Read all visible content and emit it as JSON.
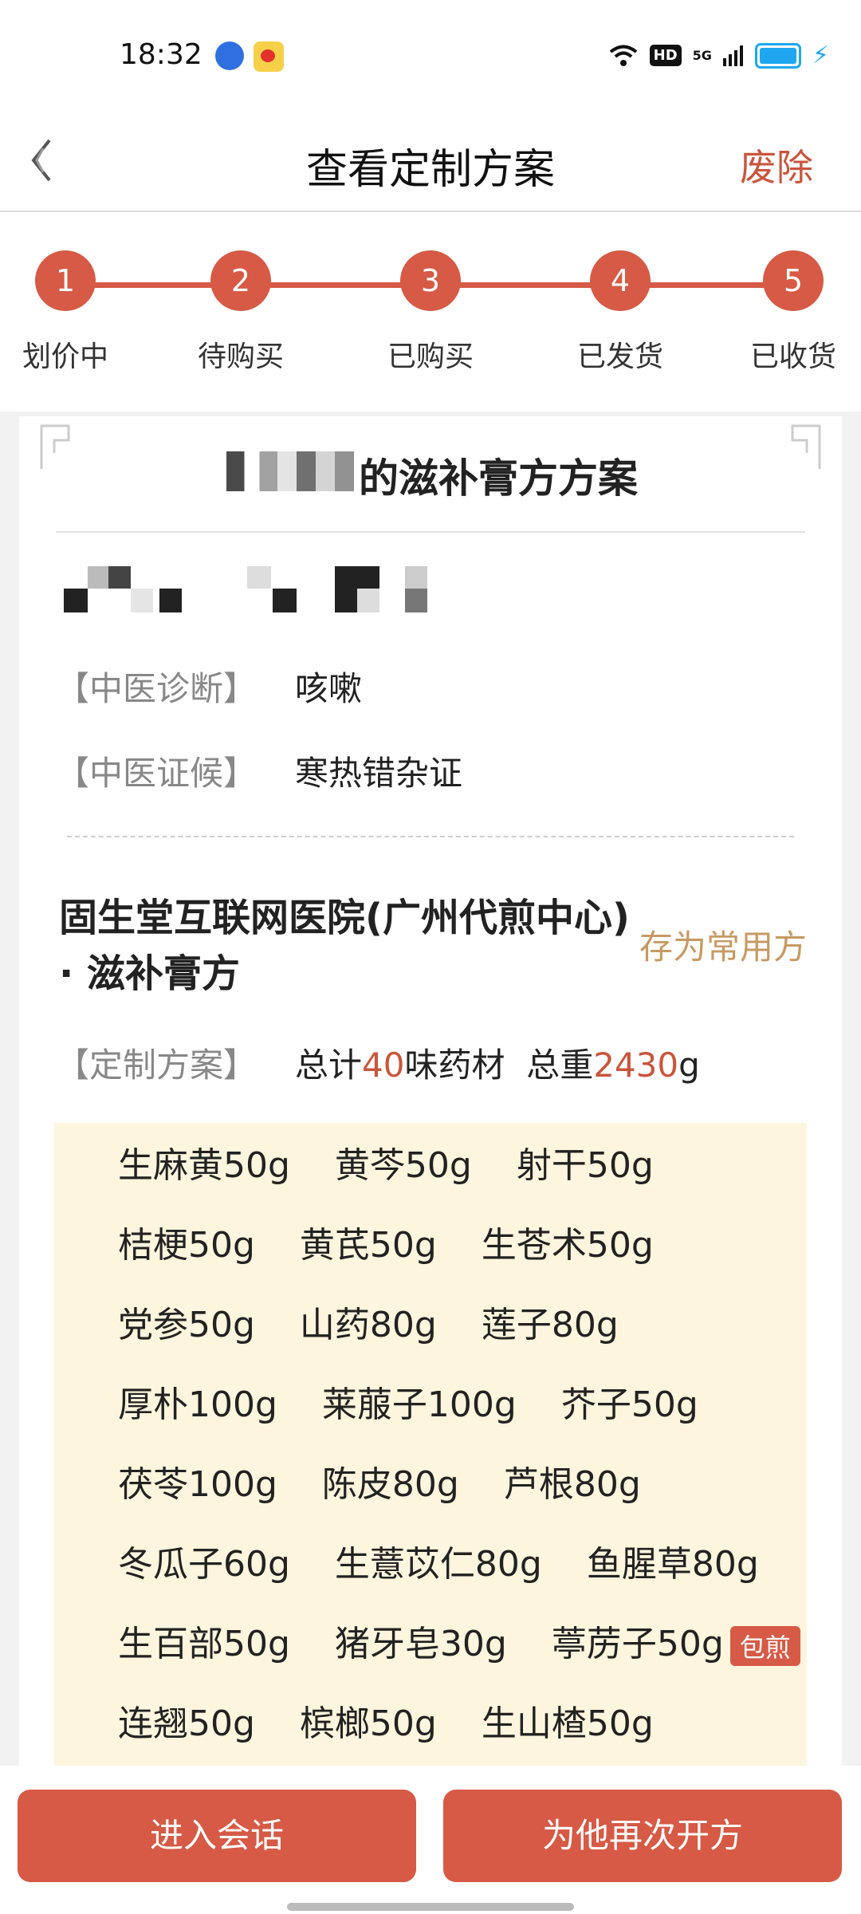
{
  "status_bar": {
    "time": "18:32",
    "hd": "HD",
    "network": "5G"
  },
  "header": {
    "title": "查看定制方案",
    "action": "废除"
  },
  "steps": [
    {
      "num": "1",
      "label": "划价中"
    },
    {
      "num": "2",
      "label": "待购买"
    },
    {
      "num": "3",
      "label": "已购买"
    },
    {
      "num": "4",
      "label": "已发货"
    },
    {
      "num": "5",
      "label": "已收货"
    }
  ],
  "card": {
    "title_suffix": "的滋补膏方方案",
    "diagnosis_label": "【中医诊断】",
    "diagnosis_value": "咳嗽",
    "syndrome_label": "【中医证候】",
    "syndrome_value": "寒热错杂证",
    "hospital": "固生堂互联网医院(广州代煎中心) · 滋补膏方",
    "save_label": "存为常用方",
    "plan_label": "【定制方案】",
    "plan_total_prefix": "总计",
    "plan_count": "40",
    "plan_count_suffix": "味药材",
    "plan_weight_prefix": "总重",
    "plan_weight": "2430",
    "plan_weight_unit": "g"
  },
  "herb_rows": [
    [
      "生麻黄50g",
      "黄芩50g",
      "射干50g"
    ],
    [
      "桔梗50g",
      "黄芪50g",
      "生苍术50g"
    ],
    [
      "党参50g",
      "山药80g",
      "莲子80g"
    ],
    [
      "厚朴100g",
      "莱菔子100g",
      "芥子50g"
    ],
    [
      "茯苓100g",
      "陈皮80g",
      "芦根80g"
    ],
    [
      "冬瓜子60g",
      "生薏苡仁80g",
      "鱼腥草80g"
    ],
    [
      "生百部50g",
      "猪牙皂30g",
      "葶苈子50g"
    ],
    [
      "连翘50g",
      "槟榔50g",
      "生山楂50g"
    ]
  ],
  "badge_label": "包煎",
  "bottom": {
    "left_button": "进入会话",
    "right_button": "为他再次开方"
  },
  "colors": {
    "accent": "#d65a45",
    "gold": "#c79a63",
    "herb_bg": "#fdf5dd"
  }
}
